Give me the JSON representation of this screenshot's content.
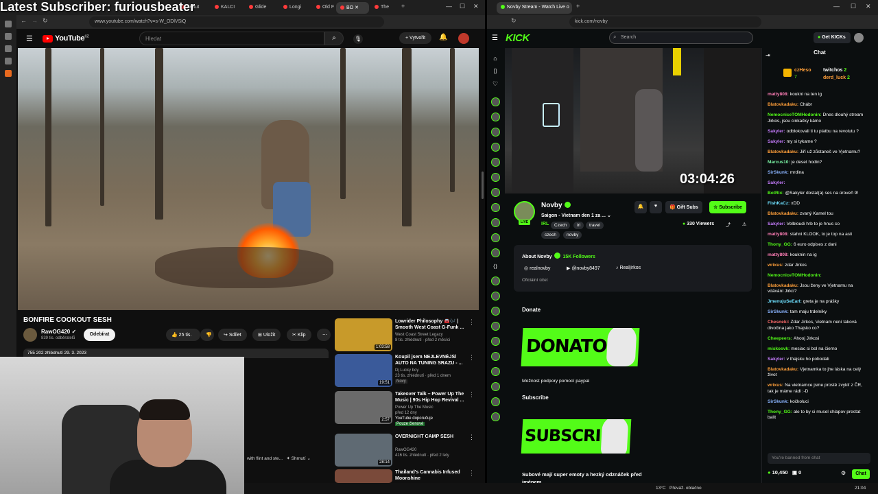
{
  "overlay": {
    "title": "Latest Subscriber: furiousbeater"
  },
  "left_window": {
    "tabs": [
      "Beaut",
      "KALCI",
      "Glide",
      "Longi",
      "Old F",
      "BO",
      "The"
    ],
    "url": "www.youtube.com/watch?v=s-W_ODlVSiQ"
  },
  "right_window": {
    "tab": "Novby Stream - Watch Live o",
    "url": "kick.com/novby"
  },
  "youtube": {
    "logo": "YouTube",
    "logo_sup": "CZ",
    "search_placeholder": "Hledat",
    "create_label": "Vytvořit",
    "video_title": "BONFIRE COOKOUT SESH",
    "channel": "RawOG420",
    "channel_subs": "839 tis. odběratelů",
    "subscribe_label": "Odebírat",
    "likes": "25 tis.",
    "share_label": "Sdílet",
    "save_label": "Uložit",
    "clip_label": "Klip",
    "meta": "755 202 zhlédnutí  29. 3. 2023",
    "chapter_text": "with flint and ste...",
    "chapter_summary": "Shrnutí",
    "recommended": [
      {
        "title": "Lowrider Philosophy 🚘🎶 | Smooth West Coast G-Funk ...",
        "channel": "West Coast Street Legacy",
        "meta": "8 tis. zhlédnutí · před 2 měsíci",
        "duration": "1:03:58",
        "badge": "",
        "color": "#c89a2a"
      },
      {
        "title": "Koupil jsem NEJLEVNĚJŠÍ AUTO NA TUNING SRAZU - ...",
        "channel": "Dj Lucky boy",
        "meta": "23 tis. zhlédnutí · před 1 dnem",
        "duration": "19:51",
        "badge": "Nový",
        "color": "#3a5a9a"
      },
      {
        "title": "Takeover Talk – Power Up The Music | 90s Hip Hop Revival ...",
        "channel": "Power Up The Music",
        "meta": "před 12 dny",
        "duration": "2:57",
        "badge": "YouTube doporučuje",
        "extra": "Pouze členové",
        "color": "#6a6a6a"
      },
      {
        "title": "OVERNIGHT CAMP SESH",
        "channel": "RawOG420",
        "meta": "416 tis. zhlédnutí · před 2 lety",
        "duration": "28:14",
        "badge": "",
        "color": "#5f6a73"
      },
      {
        "title": "Thailand's Cannabis Infused Moonshine",
        "channel": "",
        "meta": "",
        "duration": "",
        "badge": "",
        "color": "#7a4a3a"
      }
    ]
  },
  "kick": {
    "logo": "KICK",
    "search_placeholder": "Search",
    "get_kicks": "Get KICKs",
    "timer": "03:04:26",
    "streamer": "Novby",
    "live": "LIVE",
    "stream_title": "Saigon - Vietnam den 1 za ...",
    "category": "IRL",
    "tags": [
      "Czech",
      "irl",
      "travel",
      "czech",
      "novby"
    ],
    "gift_subs": "Gift Subs",
    "subscribe": "Subscribe",
    "viewers": "330 Viewers",
    "about_title": "About Novby",
    "followers": "15K Followers",
    "socials": [
      "realnovby",
      "@novby8497",
      "Realjirkos"
    ],
    "official": "Oficiální účet",
    "donate_heading": "Donate",
    "donate_banner": "DONATOSS",
    "donate_caption": "Možnost podpory pomocí paypal",
    "subscribe_heading": "Subscribe",
    "subscribe_banner": "SUBSCRIBE",
    "subscribe_caption": "Subové mají super emoty a hezký odznáček před jménem"
  },
  "chat": {
    "title": "Chat",
    "pinned": [
      {
        "user": "czHeso",
        "count": "7"
      },
      {
        "user": "twitchos",
        "count": "2"
      },
      {
        "user": "derd_luck",
        "count": "2"
      }
    ],
    "messages": [
      {
        "user": "matty808:",
        "text": "koukni na ten ig",
        "color": "#ff7eb6"
      },
      {
        "user": "Blatovkadaku:",
        "text": "Chábr",
        "color": "#ff9f3a"
      },
      {
        "user": "NemocniceTOMHodonin:",
        "text": "Dnes dlouhý stream Jirkos, jsou cinkačky kámo",
        "color": "#53fc18"
      },
      {
        "user": "Sakyler:",
        "text": "odblokovali ti tu platbu na revolutu ?",
        "color": "#c77dff"
      },
      {
        "user": "Sakyler:",
        "text": "my si tykame ?",
        "color": "#c77dff"
      },
      {
        "user": "Blatovkadaku:",
        "text": "Jiří už zůstaneš ve Vjetnamu?",
        "color": "#ff9f3a"
      },
      {
        "user": "Marcus10:",
        "text": "je deset hodin?",
        "color": "#7cf7a6"
      },
      {
        "user": "SirSkunk:",
        "text": "mrdina",
        "color": "#8ab4ff"
      },
      {
        "user": "Sakyler:",
        "text": "",
        "color": "#c77dff"
      },
      {
        "user": "BotRix:",
        "text": "@Sakyler dostal(a) ses na úroveň 9!",
        "color": "#53fc18"
      },
      {
        "user": "FishKaCz:",
        "text": "xDD",
        "color": "#6ee0ff"
      },
      {
        "user": "Blatovkadaku:",
        "text": "zvaný Kamel tou",
        "color": "#ff9f3a"
      },
      {
        "user": "Sakyler:",
        "text": "Velbloudi hrb to je hnus co",
        "color": "#c77dff"
      },
      {
        "user": "matty808:",
        "text": "stahni KLOOK, to je top na asii",
        "color": "#ff7eb6"
      },
      {
        "user": "Thony_GG:",
        "text": "6 euro odpises z dani",
        "color": "#53fc18"
      },
      {
        "user": "matty808:",
        "text": "kouknin na ig",
        "color": "#ff7eb6"
      },
      {
        "user": "wrixus:",
        "text": "zdar Jirkos",
        "color": "#ff9f3a"
      },
      {
        "user": "NemocniceTOMHodonin:",
        "text": "",
        "color": "#53fc18"
      },
      {
        "user": "Blatovkadaku:",
        "text": "Jsou ženy ve Vjetnamu na vdávání Jirko?",
        "color": "#ff9f3a"
      },
      {
        "user": "JmenujuSeEarl:",
        "text": "greta je na prášky",
        "color": "#6ee0ff"
      },
      {
        "user": "SirSkunk:",
        "text": "tam maju trdelniky",
        "color": "#8ab4ff"
      },
      {
        "user": "Chesneki:",
        "text": "Zdar Jirkos, Vietnam není taková divočina jako Thajsko co?",
        "color": "#ff6b6b"
      },
      {
        "user": "Cheepeers:",
        "text": "Ahooj Jirkosi",
        "color": "#53fc18"
      },
      {
        "user": "miskosvk:",
        "text": "mesiac si bol na čiernо",
        "color": "#53fc18"
      },
      {
        "user": "Sakyler:",
        "text": "v thajsku ho pobodali",
        "color": "#c77dff"
      },
      {
        "user": "Blatovkadaku:",
        "text": "Vjetnamka to jhe láska na celý život",
        "color": "#ff9f3a"
      },
      {
        "user": "wrixus:",
        "text": "Na vietnamce jsme prostě zvyklí z ČR, tak je máme rádi :-D",
        "color": "#ff9f3a"
      },
      {
        "user": "SirSkunk:",
        "text": "kočkoluci",
        "color": "#8ab4ff"
      },
      {
        "user": "Thony_GG:",
        "text": "ale to by si musel chlapov prestat balit",
        "color": "#53fc18"
      }
    ],
    "input_placeholder": "You're banned from chat",
    "points": "10,450",
    "zero": "0",
    "send": "Chat"
  },
  "taskbar": {
    "weather": "13°C",
    "weather_desc": "Převáž. oblačno",
    "time": "21:04"
  }
}
